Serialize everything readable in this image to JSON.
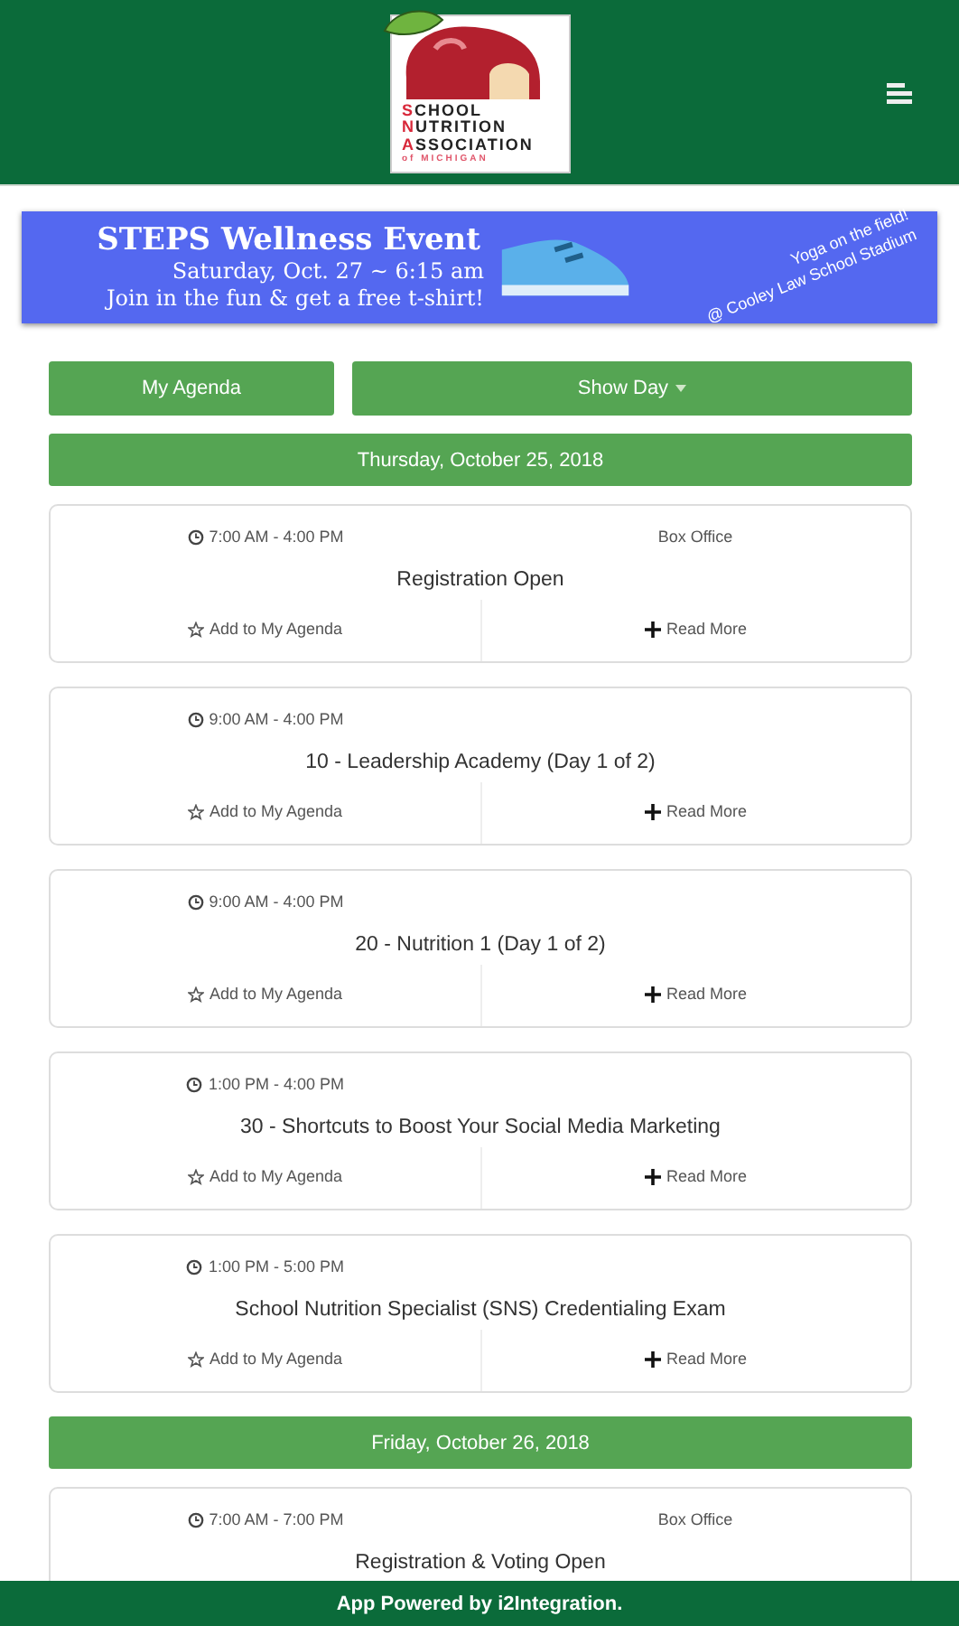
{
  "header": {
    "logo_lines": [
      "SCHOOL",
      "NUTRITION",
      "ASSOCIATION",
      "of MICHIGAN"
    ]
  },
  "banner": {
    "title": "STEPS Wellness Event",
    "date": "Saturday, Oct. 27 ~ 6:15 am",
    "tagline": "Join in the fun & get a free t-shirt!",
    "note_lines": [
      "Yoga on the field!",
      "@ Cooley Law School Stadium"
    ]
  },
  "toolbar": {
    "agenda_button": "My Agenda",
    "day_button": "Show Day"
  },
  "days": [
    {
      "date": "Thursday, October 25, 2018",
      "sessions": [
        {
          "time": "7:00 AM - 4:00 PM",
          "location": "Box Office",
          "title": "Registration Open",
          "add": "Add to My Agenda",
          "more": "Read More"
        },
        {
          "time": "9:00 AM - 4:00 PM",
          "title": "10 - Leadership Academy (Day 1 of 2)",
          "add": "Add to My Agenda",
          "more": "Read More"
        },
        {
          "time": "9:00 AM - 4:00 PM",
          "title": "20 - Nutrition 1 (Day 1 of 2)",
          "add": "Add to My Agenda",
          "more": "Read More"
        },
        {
          "time": "1:00 PM - 4:00 PM",
          "title": "30 - Shortcuts to Boost Your Social Media Marketing",
          "add": "Add to My Agenda",
          "more": "Read More"
        },
        {
          "time": "1:00 PM - 5:00 PM",
          "title": "School Nutrition Specialist (SNS) Credentialing Exam",
          "add": "Add to My Agenda",
          "more": "Read More"
        }
      ]
    },
    {
      "date": "Friday, October 26, 2018",
      "sessions": [
        {
          "time": "7:00 AM - 7:00 PM",
          "location": "Box Office",
          "title": "Registration & Voting Open"
        }
      ]
    }
  ],
  "footer": {
    "text": "App Powered by i2Integration."
  }
}
